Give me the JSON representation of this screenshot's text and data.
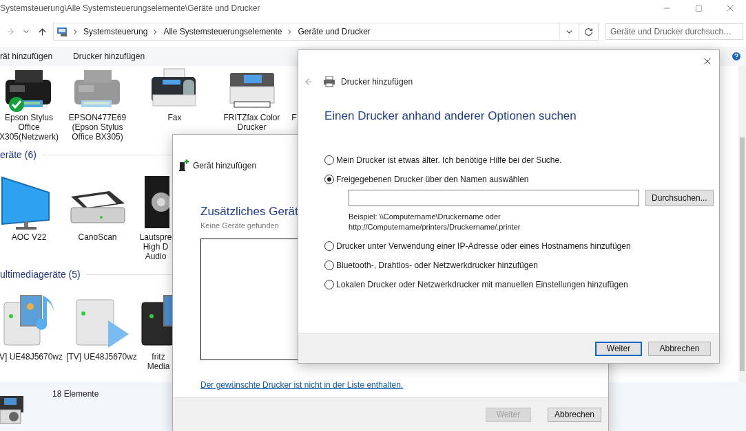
{
  "explorer": {
    "title": "Systemsteuerung\\Alle Systemsteuerungselemente\\Geräte und Drucker",
    "breadcrumb": [
      "Systemsteuerung",
      "Alle Systemsteuerungselemente",
      "Geräte und Drucker"
    ],
    "search": {
      "placeholder": "Geräte und Drucker durchsuch…"
    },
    "commands": [
      "rät hinzufügen",
      "Drucker hinzufügen"
    ],
    "groups": [
      {
        "devices": [
          {
            "kind": "inkjet",
            "lines": [
              "Epson Stylus",
              "Office",
              "X305(Netzwerk)"
            ],
            "default": true,
            "offline": false
          },
          {
            "kind": "inkjet",
            "lines": [
              "EPSON477E69",
              "(Epson Stylus",
              "Office BX305)"
            ],
            "default": false,
            "offline": true
          },
          {
            "kind": "fax",
            "lines": [
              "Fax"
            ],
            "default": false,
            "offline": false
          },
          {
            "kind": "photo-printer",
            "lines": [
              "FRITZfax Color",
              "Drucker"
            ],
            "default": false,
            "offline": false
          },
          {
            "lines": [
              "F"
            ]
          }
        ]
      },
      {
        "title": "eräte (6)",
        "devices": [
          {
            "kind": "monitor",
            "lines": [
              "AOC V22"
            ],
            "default": false,
            "offline": false
          },
          {
            "kind": "scanner",
            "lines": [
              "CanoScan"
            ],
            "default": false,
            "offline": false
          },
          {
            "kind": "speaker",
            "lines": [
              "Lautspre",
              "High D",
              "Audio"
            ],
            "default": false,
            "offline": false
          }
        ]
      },
      {
        "title": "ultimediageräte (5)",
        "devices": [
          {
            "kind": "media-film",
            "lines": [
              "V] UE48J5670wz"
            ],
            "default": false,
            "offline": false
          },
          {
            "kind": "media-play",
            "lines": [
              "[TV] UE48J5670wz"
            ],
            "default": false,
            "offline": false
          },
          {
            "kind": "media-dark",
            "lines": [
              "fritz",
              "Media"
            ],
            "default": false,
            "offline": false
          }
        ]
      }
    ],
    "status": "18 Elemente"
  },
  "add_device_dialog": {
    "title": "Gerät hinzufügen",
    "heading": "Zusätzliches Gerät",
    "subtitle": "Keine Geräte gefunden",
    "link": "Der gewünschte Drucker ist nicht in der Liste enthalten.",
    "buttons": [
      {
        "label": "Weiter",
        "disabled": true,
        "default": false
      },
      {
        "label": "Abbrechen",
        "disabled": false,
        "default": false
      }
    ]
  },
  "add_printer_dialog": {
    "title": "Drucker hinzufügen",
    "heading": "Einen Drucker anhand anderer Optionen suchen",
    "options": [
      {
        "label": "Mein Drucker ist etwas älter. Ich benötige Hilfe bei der Suche.",
        "selected": false
      },
      {
        "label": "Freigegebenen Drucker über den Namen auswählen",
        "selected": true,
        "browse_button": "Durchsuchen...",
        "hint_lines": [
          "Beispiel: \\\\Computername\\Druckername oder",
          "http://Computername/printers/Druckername/.printer"
        ]
      },
      {
        "label": "Drucker unter Verwendung einer IP-Adresse oder eines Hostnamens hinzufügen",
        "selected": false
      },
      {
        "label": "Bluetooth-, Drahtlos- oder Netzwerkdrucker hinzufügen",
        "selected": false
      },
      {
        "label": "Lokalen Drucker oder Netzwerkdrucker mit manuellen Einstellungen hinzufügen",
        "selected": false
      }
    ],
    "buttons": [
      {
        "label": "Weiter",
        "disabled": false,
        "default": true
      },
      {
        "label": "Abbrechen",
        "disabled": false,
        "default": false
      }
    ]
  }
}
